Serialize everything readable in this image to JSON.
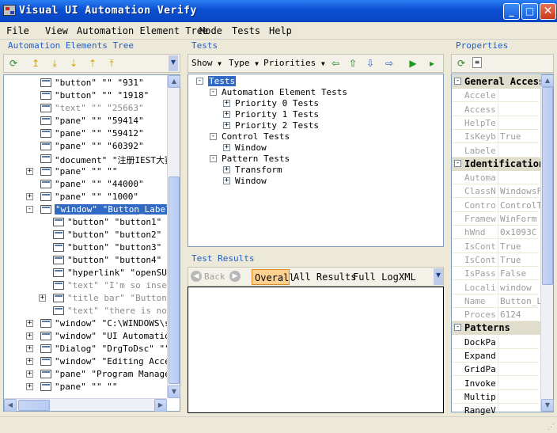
{
  "window": {
    "title": "Visual UI Automation Verify"
  },
  "menu": [
    "File",
    "View",
    "Automation Element Tree",
    "Mode",
    "Tests",
    "Help"
  ],
  "left_pane": {
    "label": "Automation Elements Tree",
    "rows": [
      {
        "text": "\"button\" \"\" \"931\"",
        "gray": false,
        "exp": ""
      },
      {
        "text": "\"button\" \"\" \"1918\"",
        "gray": false,
        "exp": ""
      },
      {
        "text": "\"text\" \"\" \"25663\"",
        "gray": true,
        "exp": ""
      },
      {
        "text": "\"pane\" \"\" \"59414\"",
        "gray": false,
        "exp": ""
      },
      {
        "text": "\"pane\" \"\" \"59412\"",
        "gray": false,
        "exp": ""
      },
      {
        "text": "\"pane\" \"\" \"60392\"",
        "gray": false,
        "exp": ""
      },
      {
        "text": "\"document\" \"注册IEST大赛",
        "gray": false,
        "exp": ""
      },
      {
        "text": "\"pane\" \"\" \"\"",
        "gray": false,
        "exp": "+"
      },
      {
        "text": "\"pane\" \"\" \"44000\"",
        "gray": false,
        "exp": ""
      },
      {
        "text": "\"pane\" \"\" \"1000\"",
        "gray": false,
        "exp": "+"
      },
      {
        "text": "\"window\" \"Button_Label_",
        "gray": false,
        "exp": "-",
        "selected": true
      },
      {
        "text": "\"button\" \"button1\" \"",
        "gray": false,
        "exp": "",
        "child": true
      },
      {
        "text": "\"button\" \"button2\" \"",
        "gray": false,
        "exp": "",
        "child": true
      },
      {
        "text": "\"button\" \"button3\" \"",
        "gray": false,
        "exp": "",
        "child": true
      },
      {
        "text": "\"button\" \"button4\" \"",
        "gray": false,
        "exp": "",
        "child": true
      },
      {
        "text": "\"hyperlink\" \"openSUS",
        "gray": false,
        "exp": "",
        "child": true
      },
      {
        "text": "\"text\" \"I'm so insen",
        "gray": true,
        "exp": "",
        "child": true
      },
      {
        "text": "\"title bar\" \"Button_",
        "gray": true,
        "exp": "+",
        "child": true
      },
      {
        "text": "\"text\" \"there is not",
        "gray": true,
        "exp": "",
        "child": true
      },
      {
        "text": "\"window\" \"C:\\WINDOWS\\sy",
        "gray": false,
        "exp": "+"
      },
      {
        "text": "\"window\" \"UI Automation",
        "gray": false,
        "exp": "+"
      },
      {
        "text": "\"Dialog\" \"DrgToDsc\" \"\"",
        "gray": false,
        "exp": "+"
      },
      {
        "text": "\"window\" \"Editing Acces",
        "gray": false,
        "exp": "+"
      },
      {
        "text": "\"pane\" \"Program Manager",
        "gray": false,
        "exp": "+"
      },
      {
        "text": "\"pane\" \"\" \"\"",
        "gray": false,
        "exp": "+"
      }
    ]
  },
  "tests_pane": {
    "label": "Tests",
    "toolbar": {
      "show": "Show",
      "type": "Type",
      "priorities": "Priorities"
    },
    "tree": [
      {
        "text": "Tests",
        "level": 0,
        "exp": "-",
        "selected": true
      },
      {
        "text": "Automation Element Tests",
        "level": 1,
        "exp": "-"
      },
      {
        "text": "Priority 0 Tests",
        "level": 2,
        "exp": "+"
      },
      {
        "text": "Priority 1 Tests",
        "level": 2,
        "exp": "+"
      },
      {
        "text": "Priority 2 Tests",
        "level": 2,
        "exp": "+"
      },
      {
        "text": "Control Tests",
        "level": 1,
        "exp": "-"
      },
      {
        "text": "Window",
        "level": 2,
        "exp": "+"
      },
      {
        "text": "Pattern Tests",
        "level": 1,
        "exp": "-"
      },
      {
        "text": "Transform",
        "level": 2,
        "exp": "+"
      },
      {
        "text": "Window",
        "level": 2,
        "exp": "+"
      }
    ]
  },
  "results_pane": {
    "label": "Test Results",
    "back": "Back",
    "tabs": [
      "Overall",
      "All Results",
      "Full Log",
      "XML"
    ]
  },
  "properties_pane": {
    "label": "Properties",
    "rows": [
      {
        "cat": "General Access"
      },
      {
        "k": "Accele",
        "v": ""
      },
      {
        "k": "Access",
        "v": ""
      },
      {
        "k": "HelpTe",
        "v": ""
      },
      {
        "k": "IsKeyb",
        "v": "True"
      },
      {
        "k": "Labele",
        "v": ""
      },
      {
        "cat": "Identification"
      },
      {
        "k": "Automa",
        "v": ""
      },
      {
        "k": "ClassN",
        "v": "WindowsFo"
      },
      {
        "k": "Contro",
        "v": "ControlTy"
      },
      {
        "k": "Framew",
        "v": "WinForm"
      },
      {
        "k": "hWnd",
        "v": "0x1093C"
      },
      {
        "k": "IsCont",
        "v": "True"
      },
      {
        "k": "IsCont",
        "v": "True"
      },
      {
        "k": "IsPass",
        "v": "False"
      },
      {
        "k": "Locali",
        "v": "window"
      },
      {
        "k": "Name",
        "v": "Button_La"
      },
      {
        "k": "Proces",
        "v": "6124"
      },
      {
        "cat": "Patterns"
      },
      {
        "k": "DockPa",
        "v": "",
        "black": true
      },
      {
        "k": "Expand",
        "v": "",
        "black": true
      },
      {
        "k": "GridPa",
        "v": "",
        "black": true
      },
      {
        "k": "Invoke",
        "v": "",
        "black": true
      },
      {
        "k": "Multip",
        "v": "",
        "black": true
      },
      {
        "k": "RangeV",
        "v": "",
        "black": true
      }
    ]
  }
}
